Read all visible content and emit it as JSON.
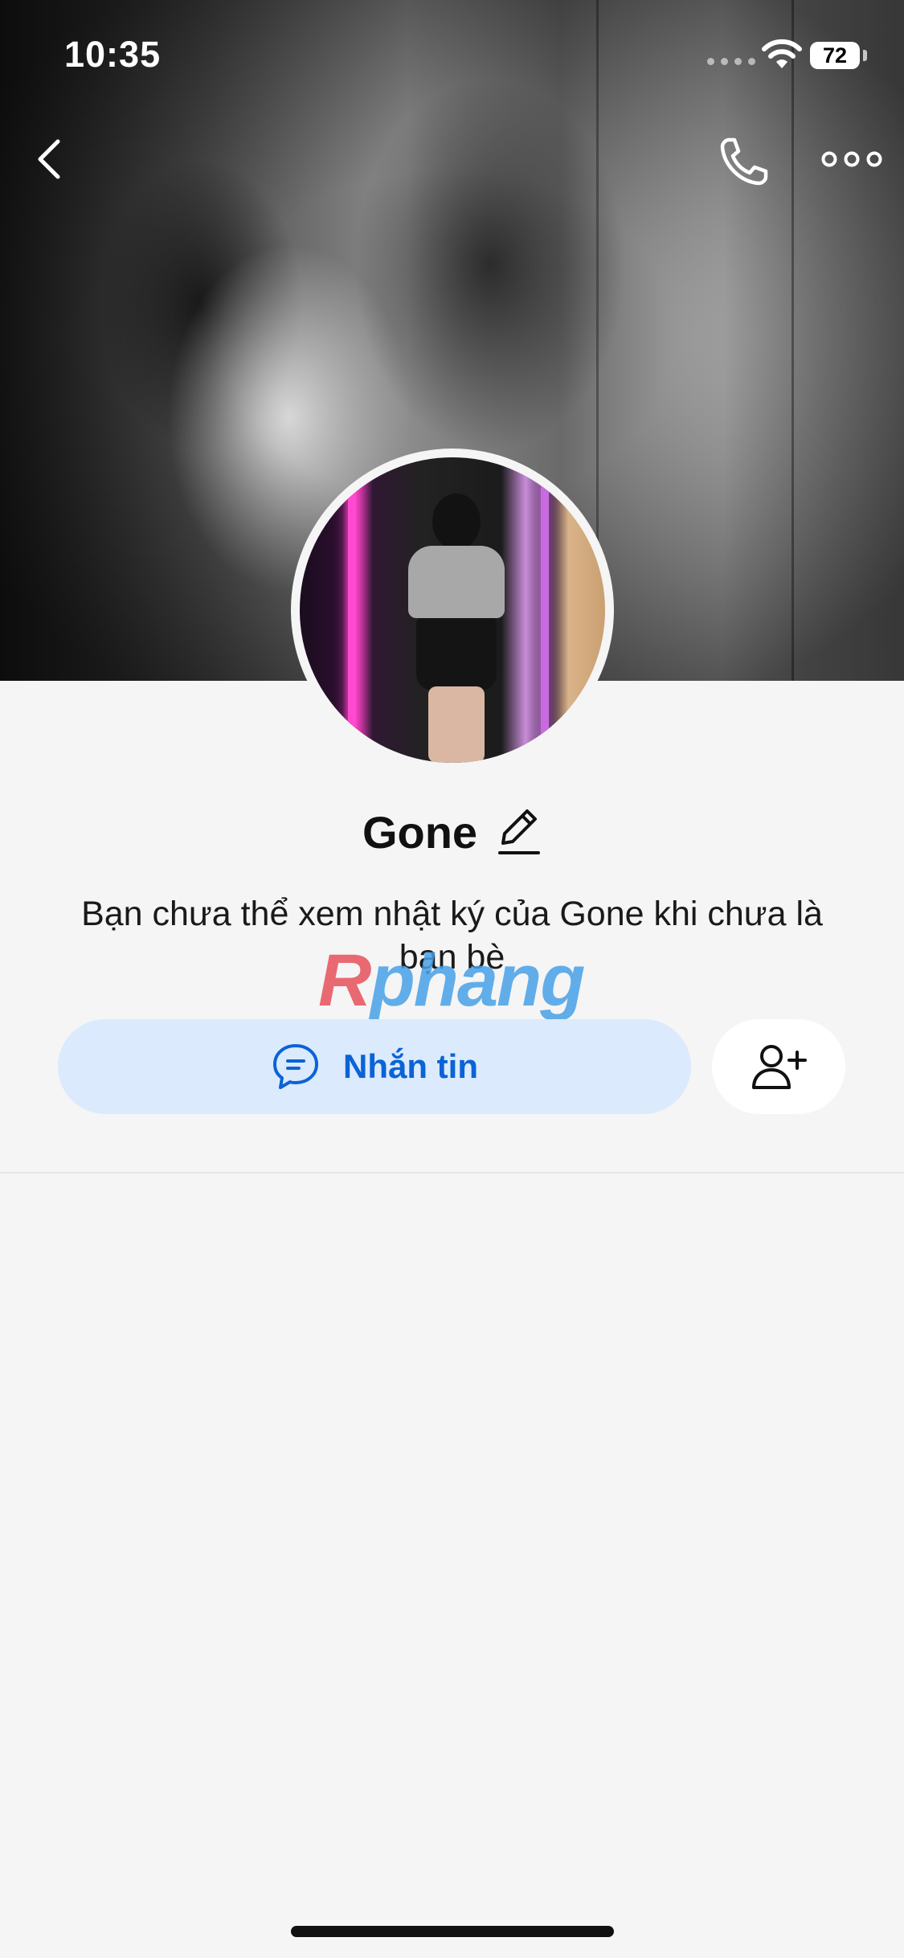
{
  "status_bar": {
    "time": "10:35",
    "battery": "72"
  },
  "header": {
    "back_icon": "chevron-left-icon",
    "call_icon": "phone-icon",
    "more_icon": "more-horizontal-icon"
  },
  "profile": {
    "name": "Gone",
    "edit_icon": "pencil-icon",
    "description": "Bạn chưa thể xem nhật ký của Gone khi chưa là bạn bè"
  },
  "watermark": {
    "first": "R",
    "rest": "phang"
  },
  "actions": {
    "message_label": "Nhắn tin",
    "message_icon": "chat-bubble-icon",
    "add_friend_icon": "add-user-icon"
  },
  "colors": {
    "accent": "#0b63d6",
    "message_button_bg": "#dbeafd",
    "page_bg": "#f5f5f5"
  }
}
